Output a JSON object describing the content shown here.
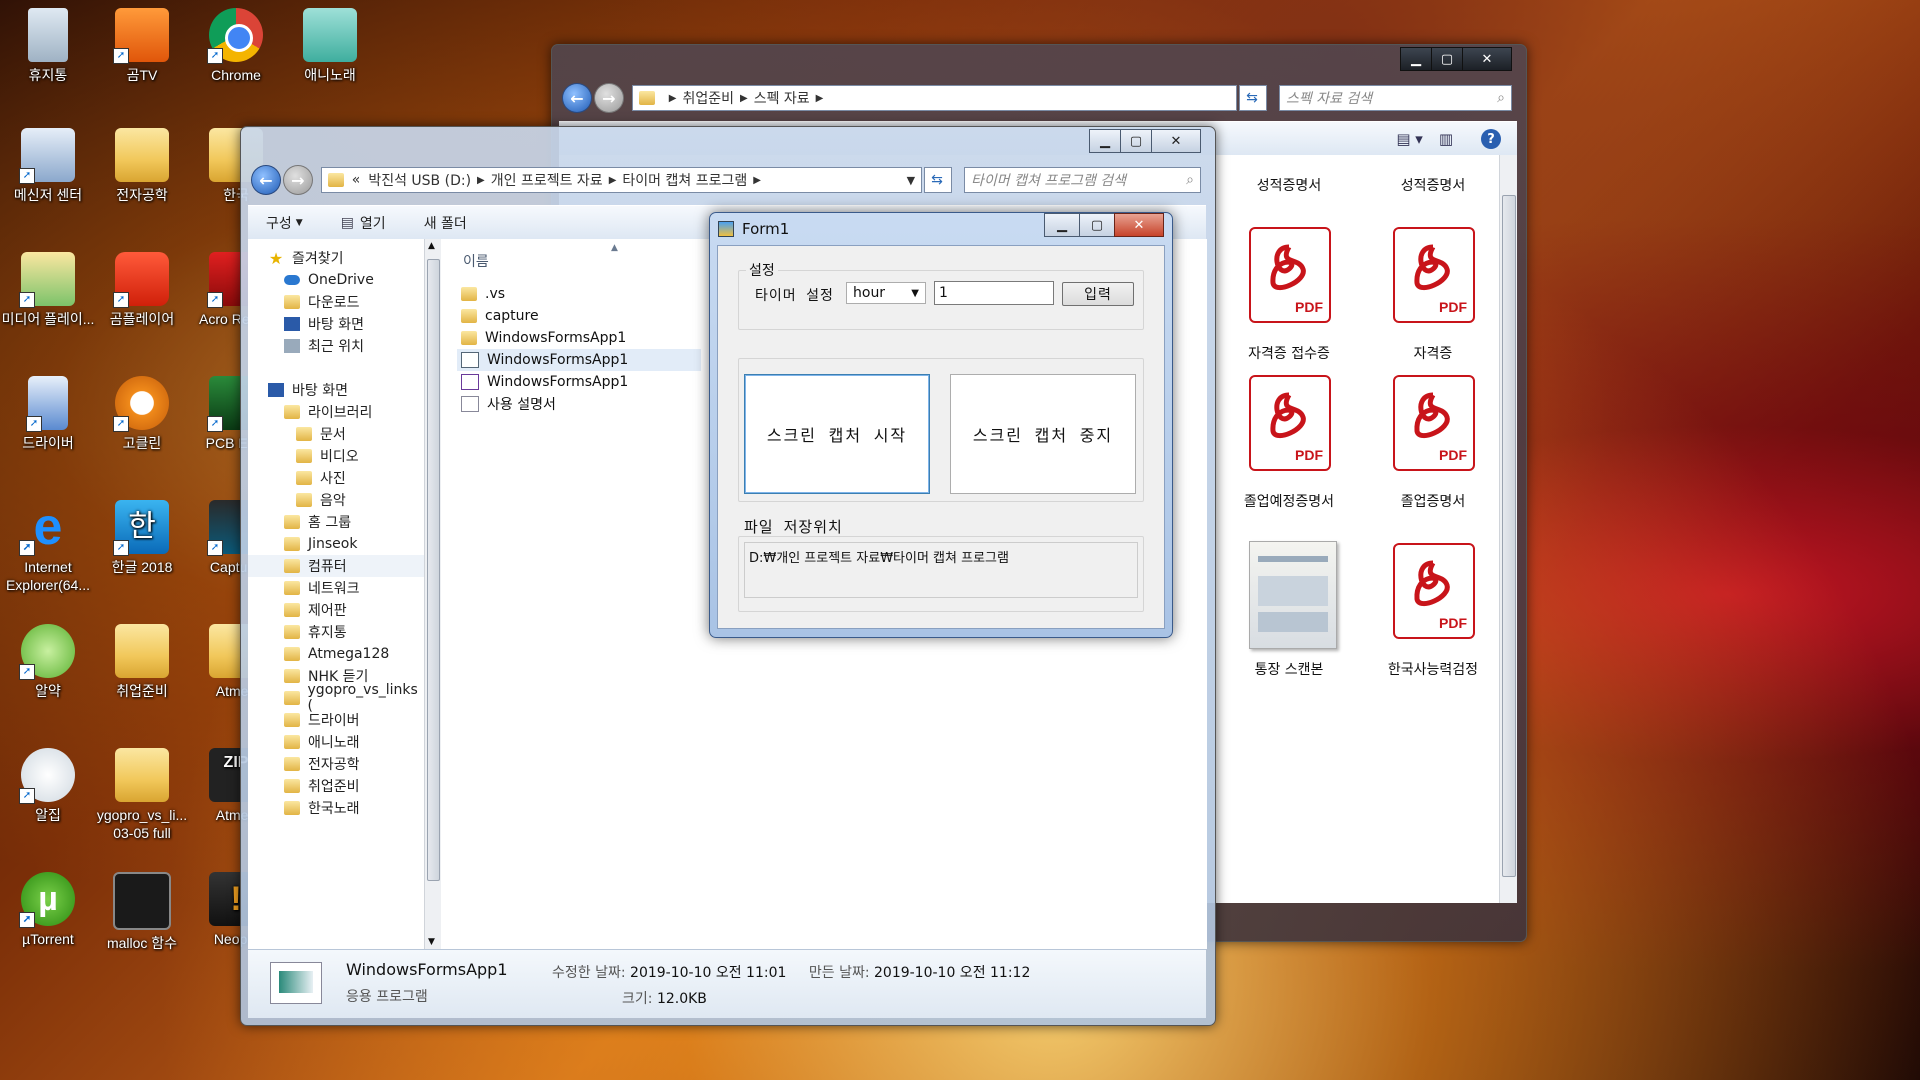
{
  "desktop": {
    "icons": [
      {
        "label": "휴지통"
      },
      {
        "label": "곰TV"
      },
      {
        "label": "Chrome"
      },
      {
        "label": "애니노래"
      },
      {
        "label": "메신저 센터"
      },
      {
        "label": "전자공학"
      },
      {
        "label": "한국"
      },
      {
        "label": "미디어 플레이..."
      },
      {
        "label": "곰플레이어"
      },
      {
        "label": "Acro Reade"
      },
      {
        "label": "드라이버"
      },
      {
        "label": "고클린"
      },
      {
        "label": "PCB E Lit"
      },
      {
        "label": "Internet Explorer(64..."
      },
      {
        "label": "한글 2018"
      },
      {
        "label": "Captu Li"
      },
      {
        "label": "알약"
      },
      {
        "label": "취업준비"
      },
      {
        "label": "Atmeg"
      },
      {
        "label": "알집"
      },
      {
        "label": "ygopro_vs_li... 03-05 full"
      },
      {
        "label": "Atmeg"
      },
      {
        "label": "µTorrent"
      },
      {
        "label": "malloc 함수"
      },
      {
        "label": "Neople"
      }
    ]
  },
  "back_window": {
    "breadcrumb": [
      "취업준비",
      "스펙 자료"
    ],
    "search_placeholder": "스펙 자료 검색",
    "files": [
      {
        "label": "성적증명서"
      },
      {
        "label": "성적증명서"
      },
      {
        "label": "자격증 접수증"
      },
      {
        "label": "자격증"
      },
      {
        "label": "졸업예정증명서"
      },
      {
        "label": "졸업증명서"
      },
      {
        "label": "통장 스캔본"
      },
      {
        "label": "한국사능력검정"
      }
    ],
    "pdf_text": "PDF"
  },
  "explorer": {
    "breadcrumb_prefix": "«",
    "breadcrumb": [
      "박진석 USB (D:)",
      "개인 프로젝트 자료",
      "타이머 캡쳐 프로그램"
    ],
    "search_placeholder": "타이머 캡쳐 프로그램 검색",
    "toolbar": {
      "organize": "구성",
      "open": "열기",
      "new_folder": "새 폴더"
    },
    "column_name": "이름",
    "nav": {
      "favorites": "즐겨찾기",
      "fav_items": [
        "OneDrive",
        "다운로드",
        "바탕 화면",
        "최근 위치"
      ],
      "desktop": "바탕 화면",
      "tree": [
        {
          "label": "라이브러리",
          "indent": 1
        },
        {
          "label": "문서",
          "indent": 2
        },
        {
          "label": "비디오",
          "indent": 2
        },
        {
          "label": "사진",
          "indent": 2
        },
        {
          "label": "음악",
          "indent": 2
        },
        {
          "label": "홈 그룹",
          "indent": 1
        },
        {
          "label": "Jinseok",
          "indent": 1
        },
        {
          "label": "컴퓨터",
          "indent": 1
        },
        {
          "label": "네트워크",
          "indent": 1
        },
        {
          "label": "제어판",
          "indent": 1
        },
        {
          "label": "휴지통",
          "indent": 1
        },
        {
          "label": "Atmega128",
          "indent": 1
        },
        {
          "label": "NHK 듣기",
          "indent": 1
        },
        {
          "label": "ygopro_vs_links (",
          "indent": 1
        },
        {
          "label": "드라이버",
          "indent": 1
        },
        {
          "label": "애니노래",
          "indent": 1
        },
        {
          "label": "전자공학",
          "indent": 1
        },
        {
          "label": "취업준비",
          "indent": 1
        },
        {
          "label": "한국노래",
          "indent": 1
        }
      ]
    },
    "files": [
      ".vs",
      "capture",
      "WindowsFormsApp1",
      "WindowsFormsApp1",
      "WindowsFormsApp1",
      "사용 설명서"
    ],
    "status": {
      "name": "WindowsFormsApp1",
      "modified_label": "수정한 날짜:",
      "modified": "2019-10-10 오전 11:01",
      "created_label": "만든 날짜:",
      "created": "2019-10-10 오전 11:12",
      "type": "응용 프로그램",
      "size_label": "크기:",
      "size": "12.0KB"
    }
  },
  "form1": {
    "title": "Form1",
    "group_label": "설정",
    "timer_label": "타이머 설정",
    "unit_value": "hour",
    "amount_value": "1",
    "input_button": "입력",
    "start_button": "스크린 캡처 시작",
    "stop_button": "스크린 캡처 중지",
    "save_label": "파일 저장위치",
    "save_path": "D:₩개인 프로젝트 자료₩타이머 캡쳐 프로그램"
  }
}
